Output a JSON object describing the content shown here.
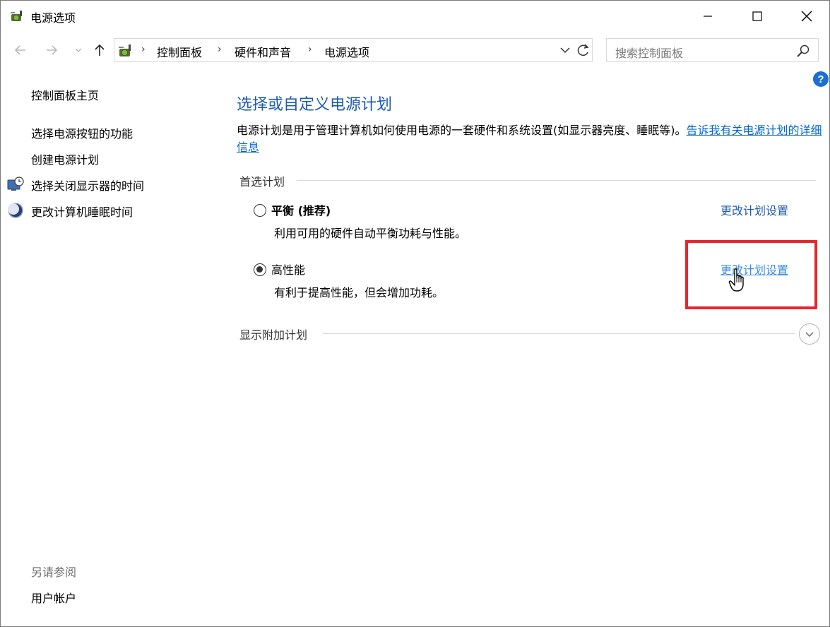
{
  "window": {
    "title": "电源选项"
  },
  "address": {
    "crumbs": [
      "控制面板",
      "硬件和声音",
      "电源选项"
    ],
    "search_placeholder": "搜索控制面板"
  },
  "sidebar": {
    "home": "控制面板主页",
    "items": [
      {
        "label": "选择电源按钮的功能",
        "icon": ""
      },
      {
        "label": "创建电源计划",
        "icon": ""
      },
      {
        "label": "选择关闭显示器的时间",
        "icon": "display-clock-icon"
      },
      {
        "label": "更改计算机睡眠时间",
        "icon": "moon-icon"
      }
    ],
    "see_also": "另请参阅",
    "user_accounts": "用户帐户"
  },
  "main": {
    "title": "选择或自定义电源计划",
    "description": "电源计划是用于管理计算机如何使用电源的一套硬件和系统设置(如显示器亮度、睡眠等)。",
    "description_link": "告诉我有关电源计划的详细信息",
    "preferred_label": "首选计划",
    "plans": [
      {
        "name": "平衡 (推荐)",
        "desc": "利用可用的硬件自动平衡功耗与性能。",
        "link": "更改计划设置",
        "selected": false
      },
      {
        "name": "高性能",
        "desc": "有利于提高性能，但会增加功耗。",
        "link": "更改计划设置",
        "selected": true
      }
    ],
    "additional_label": "显示附加计划"
  },
  "colors": {
    "accent": "#1e5bb0",
    "link": "#0066cc",
    "highlight": "#e8262d"
  }
}
